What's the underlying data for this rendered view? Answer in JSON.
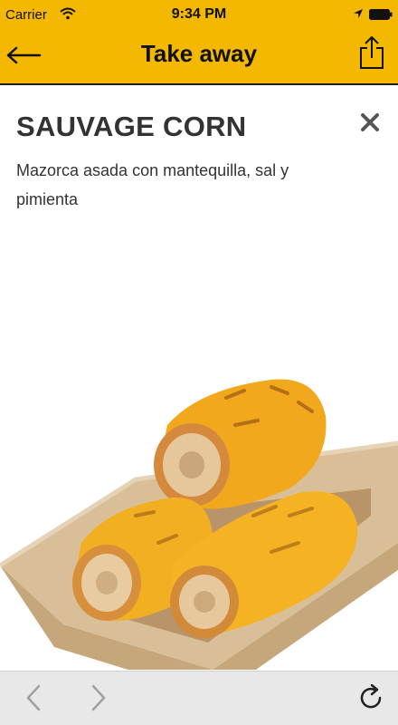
{
  "status_bar": {
    "carrier": "Carrier",
    "time": "9:34 PM"
  },
  "nav": {
    "title": "Take away",
    "back_icon": "arrow-left-icon",
    "share_icon": "share-icon"
  },
  "product": {
    "title": "SAUVAGE CORN",
    "description": "Mazorca asada con mantequilla, sal y pimienta",
    "close_icon": "close-icon"
  },
  "toolbar": {
    "back_icon": "chevron-left-icon",
    "forward_icon": "chevron-right-icon",
    "reload_icon": "reload-icon"
  },
  "colors": {
    "accent": "#F5B800",
    "text": "#333333",
    "toolbar_bg": "#e8e8e8"
  }
}
